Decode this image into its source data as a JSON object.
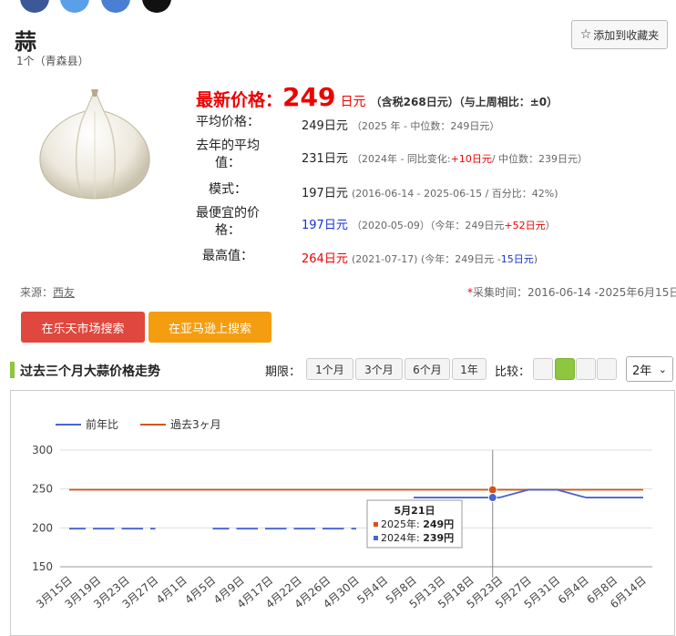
{
  "product": {
    "title": "蒜",
    "subtitle": "1个（青森县）",
    "favorite_label": "添加到收藏夹"
  },
  "latest": {
    "label": "最新价格：",
    "value": "249",
    "unit": "日元",
    "tax_note": "（含税268日元）",
    "week_note": "（与上周相比：±0）"
  },
  "stats": {
    "avg": {
      "label": "平均价格：",
      "value": "249日元",
      "note": "（2025 年 - 中位数：249日元）"
    },
    "last_year": {
      "label": "去年的平均值：",
      "value": "231日元",
      "note_a": "（2024年 - 同比变化:",
      "change": "+10日元",
      "note_b": "/ 中位数：239日元）"
    },
    "mode": {
      "label": "模式：",
      "value": "197日元",
      "note": "(2016-06-14 - 2025-06-15 / 百分比：42%)"
    },
    "min": {
      "label": "最便宜的价格：",
      "value": "197日元",
      "note_a": "（2020-05-09）（今年：249日元",
      "delta": "+52日元",
      "note_b": "）"
    },
    "max": {
      "label": "最高值：",
      "value": "264日元",
      "note_a": "(2021-07-17) (今年：249日元 -",
      "delta": "15日元",
      "note_b": ")"
    }
  },
  "source": {
    "label": "来源：",
    "link": "西友"
  },
  "collect_time": {
    "star": "*",
    "text": "采集时间：2016-06-14 -2025年6月15日"
  },
  "search": {
    "rakuten": "在乐天市场搜索",
    "amazon": "在亚马逊上搜索"
  },
  "section": {
    "title": "过去三个月大蒜价格走势",
    "period_label": "期限：",
    "periods": [
      "1个月",
      "3个月",
      "6个月",
      "1年"
    ],
    "compare_label": "比较：",
    "year_select": "2年"
  },
  "colors": {
    "accent_red": "#e00000",
    "prev_year": "#4a64d0",
    "past3m": "#d35418",
    "green": "#8dc63f"
  },
  "chart_data": {
    "type": "line",
    "categories": [
      "3月15日",
      "3月19日",
      "3月23日",
      "3月27日",
      "4月1日",
      "4月5日",
      "4月9日",
      "4月17日",
      "4月22日",
      "4月26日",
      "4月30日",
      "5月4日",
      "5月8日",
      "5月13日",
      "5月18日",
      "5月23日",
      "5月27日",
      "5月31日",
      "6月4日",
      "6月8日",
      "6月14日"
    ],
    "series": [
      {
        "name": "前年比",
        "values": [
          199,
          199,
          199,
          199,
          null,
          199,
          199,
          199,
          199,
          199,
          199,
          null,
          239,
          239,
          239,
          239,
          249,
          249,
          239,
          239,
          239
        ]
      },
      {
        "name": "過去3ヶ月",
        "values": [
          249,
          249,
          249,
          249,
          249,
          249,
          249,
          249,
          249,
          249,
          249,
          249,
          249,
          249,
          249,
          249,
          249,
          249,
          249,
          249,
          249
        ]
      }
    ],
    "yticks": [
      150,
      200,
      250,
      300
    ],
    "ylim": [
      150,
      300
    ],
    "legend_position": "top-left",
    "tooltip": {
      "date": "5月21日",
      "line1_label": "2025年:",
      "line1_value": "249円",
      "line2_label": "2024年:",
      "line2_value": "239円"
    }
  }
}
